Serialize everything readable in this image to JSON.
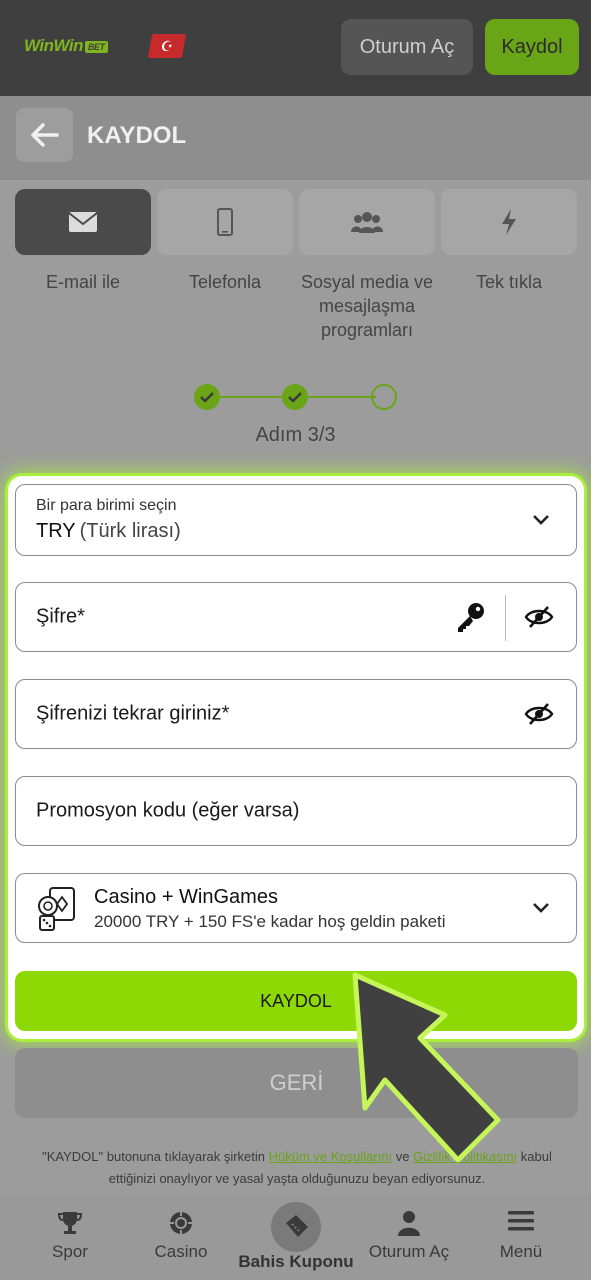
{
  "header": {
    "logo_text": "WinWin",
    "logo_badge": "BET",
    "flag_symbol": "☪",
    "login_label": "Oturum Aç",
    "register_label": "Kaydol"
  },
  "titlebar": {
    "title": "KAYDOL"
  },
  "tabs": [
    {
      "label": "E-mail ile",
      "icon": "envelope-icon",
      "active": true
    },
    {
      "label": "Telefonla",
      "icon": "phone-icon",
      "active": false
    },
    {
      "label": "Sosyal media ve mesajlaşma programları",
      "icon": "users-icon",
      "active": false
    },
    {
      "label": "Tek tıkla",
      "icon": "lightning-icon",
      "active": false
    }
  ],
  "stepper": {
    "current": 3,
    "total": 3,
    "text": "Adım 3/3"
  },
  "form": {
    "currency_label": "Bir para birimi seçin",
    "currency_code": "TRY",
    "currency_name": "(Türk lirası)",
    "password_placeholder": "Şifre*",
    "password_repeat_placeholder": "Şifrenizi tekrar giriniz*",
    "promo_placeholder": "Promosyon kodu (eğer varsa)",
    "bonus_title": "Casino + WinGames",
    "bonus_subtitle": "20000 TRY + 150 FS'e kadar hoş geldin paketi",
    "submit_label": "KAYDOL"
  },
  "back_label": "GERİ",
  "terms": {
    "part1": "\"KAYDOL\" butonuna tıklayarak şirketin ",
    "link1": "Hüküm ve Koşullarını",
    "part2": " ve ",
    "link2": "Gizlilik Politikasını",
    "part3": " kabul ettiğinizi onaylıyor ve yasal yaşta olduğunuzu beyan ediyorsunuz."
  },
  "bottom_nav": [
    {
      "label": "Spor",
      "icon": "trophy-icon"
    },
    {
      "label": "Casino",
      "icon": "casino-chip-icon"
    },
    {
      "label": "Bahis Kuponu",
      "icon": "ticket-icon"
    },
    {
      "label": "Oturum Aç",
      "icon": "user-icon"
    },
    {
      "label": "Menü",
      "icon": "hamburger-icon"
    }
  ],
  "colors": {
    "accent": "#8ed806",
    "header_bg": "#3f3f3f",
    "highlight_glow": "#a8ee3a"
  }
}
